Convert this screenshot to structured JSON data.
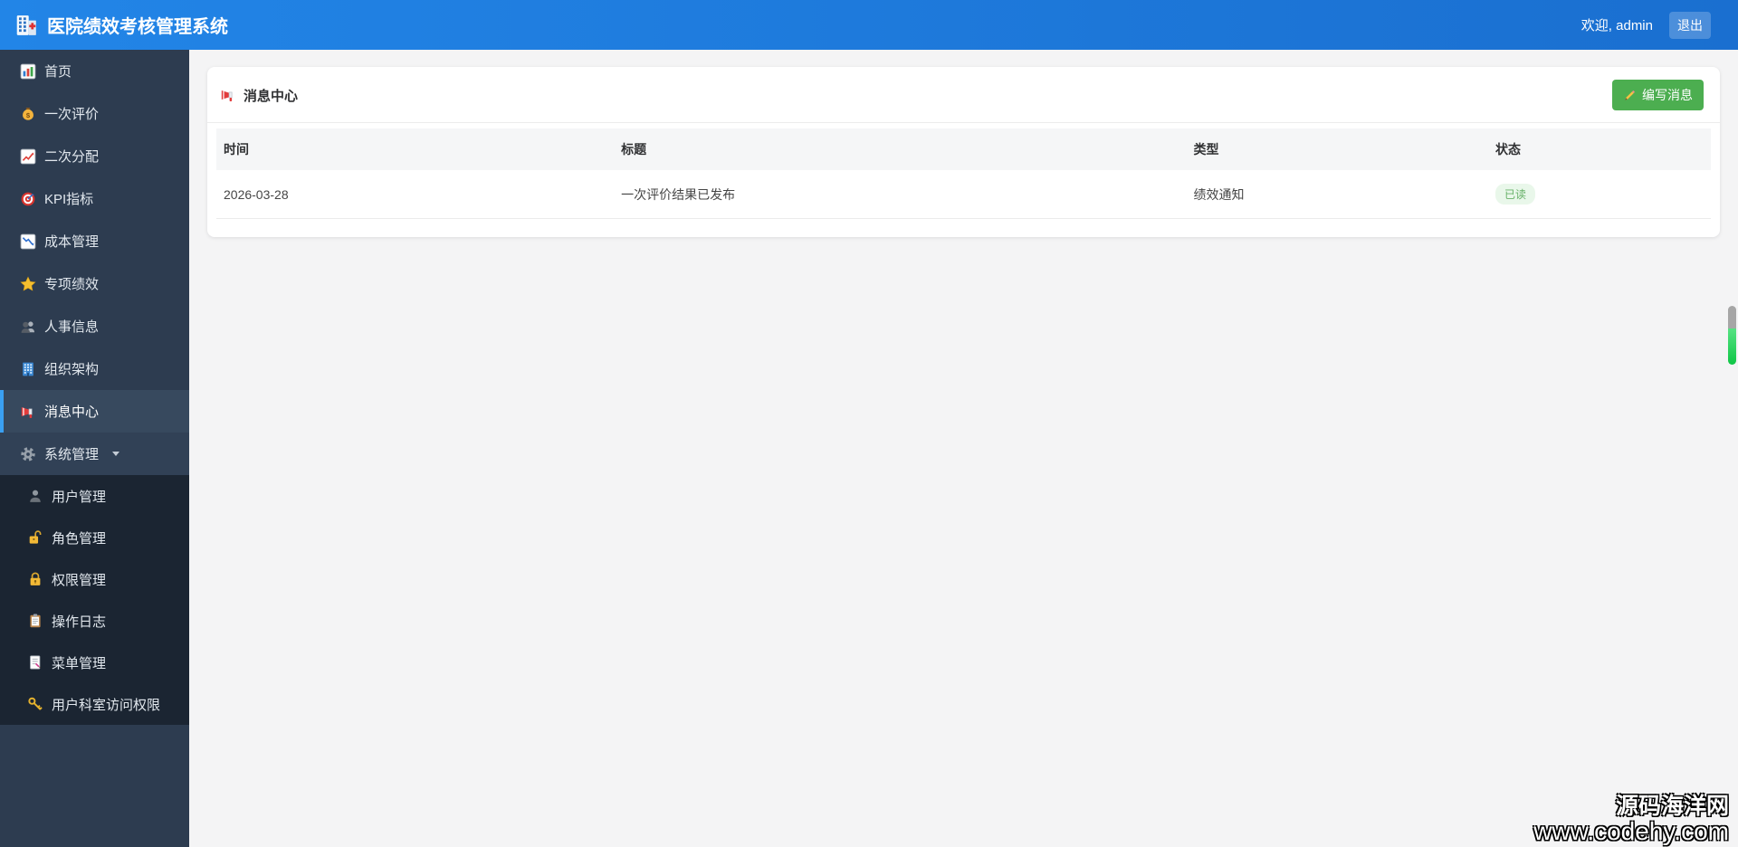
{
  "header": {
    "title": "医院绩效考核管理系统",
    "welcome": "欢迎, admin",
    "logout": "退出"
  },
  "sidebar": {
    "items": [
      {
        "label": "首页"
      },
      {
        "label": "一次评价"
      },
      {
        "label": "二次分配"
      },
      {
        "label": "KPI指标"
      },
      {
        "label": "成本管理"
      },
      {
        "label": "专项绩效"
      },
      {
        "label": "人事信息"
      },
      {
        "label": "组织架构"
      },
      {
        "label": "消息中心",
        "active": true
      },
      {
        "label": "系统管理",
        "expanded": true
      }
    ],
    "submenu": [
      {
        "label": "用户管理"
      },
      {
        "label": "角色管理"
      },
      {
        "label": "权限管理"
      },
      {
        "label": "操作日志"
      },
      {
        "label": "菜单管理"
      },
      {
        "label": "用户科室访问权限"
      }
    ]
  },
  "message_center": {
    "title": "消息中心",
    "compose_button": "编写消息",
    "table": {
      "columns": [
        "时间",
        "标题",
        "类型",
        "状态"
      ],
      "rows": [
        {
          "time": "2026-03-28",
          "title": "一次评价结果已发布",
          "type": "绩效通知",
          "status": "已读"
        }
      ]
    }
  },
  "watermark": {
    "line1": "源码海洋网",
    "line2": "www.codehy.com"
  },
  "colors": {
    "header_blue": "#1f7dde",
    "sidebar_bg": "#2d3c50",
    "sidebar_active_bg": "#37495e",
    "accent_blue": "#3aa0f2",
    "button_green": "#4cae50",
    "badge_green_bg": "#e9f7ea",
    "badge_green_text": "#67b168"
  }
}
